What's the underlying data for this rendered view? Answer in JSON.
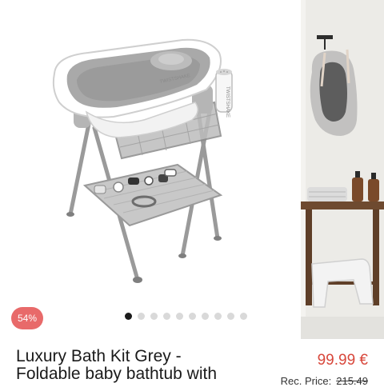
{
  "product": {
    "title_line1": "Luxury Bath Kit Grey -",
    "title_line2": "Foldable baby bathtub with",
    "price": "99.99 €",
    "rec_price_label": "Rec. Price:",
    "rec_price_value": "215.49",
    "discount": "54%"
  },
  "gallery": {
    "dot_count": 10,
    "active_dot": 0,
    "main_image_alt": "bath-kit-product-photo",
    "side_image_alt": "bath-kit-lifestyle-photo"
  },
  "brand_text": "TWISTSHAKE",
  "colors": {
    "accent": "#d8473b",
    "badge": "#e86a6a",
    "dot_active": "#1b1b1b",
    "dot_inactive": "#d9d9d9"
  }
}
